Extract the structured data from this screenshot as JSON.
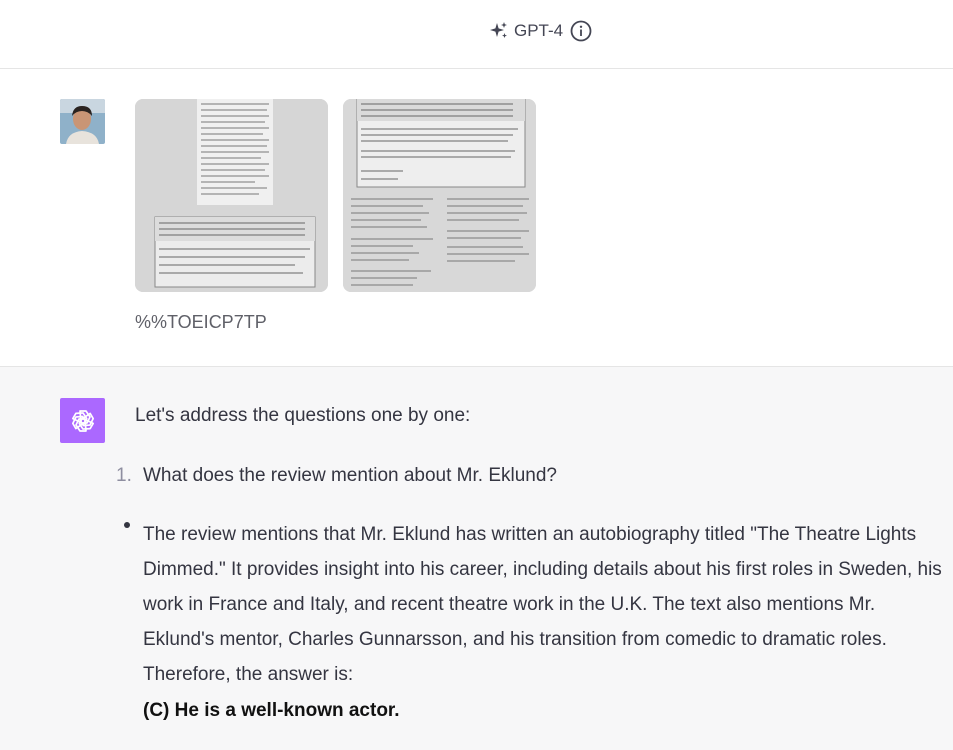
{
  "header": {
    "model_name": "GPT-4",
    "sparkle_icon": "sparkle-icon",
    "info_icon": "info-icon"
  },
  "user_message": {
    "avatar": "user-avatar",
    "attachments": [
      {
        "name": "attachment-image-1"
      },
      {
        "name": "attachment-image-2"
      }
    ],
    "text": "%%TOEICP7TP"
  },
  "assistant_message": {
    "avatar_icon": "openai-logo-icon",
    "avatar_color": "#ab68ff",
    "intro": "Let's address the questions one by one:",
    "list_number": "1.",
    "question": "What does the review mention about Mr. Eklund?",
    "paragraph": "The review mentions that Mr. Eklund has written an autobiography titled \"The Theatre Lights Dimmed.\" It provides insight into his career, including details about his first roles in Sweden, his work in France and Italy, and recent theatre work in the U.K. The text also mentions Mr. Eklund's mentor, Charles Gunnarsson, and his transition from comedic to dramatic roles. Therefore, the answer is:",
    "answer": "(C) He is a well-known actor."
  }
}
